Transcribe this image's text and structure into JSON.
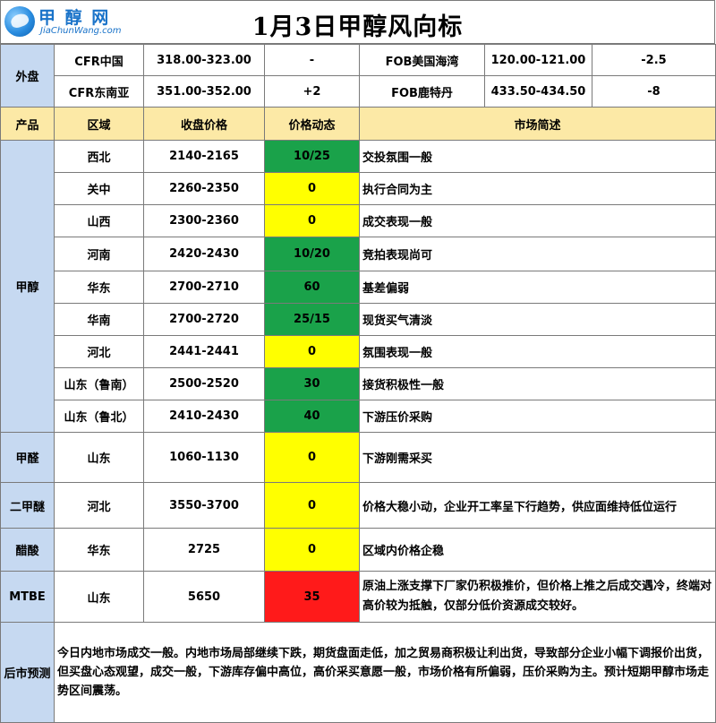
{
  "header": {
    "title": "1月3日甲醇风向标",
    "logo_cn": "甲 醇 网",
    "logo_en": "JiaChunWang.com"
  },
  "external": {
    "category": "外盘",
    "rows": [
      {
        "name1": "CFR中国",
        "price1": "318.00-323.00",
        "change1": "-",
        "name2": "FOB美国海湾",
        "price2": "120.00-121.00",
        "change2": "-2.5"
      },
      {
        "name1": "CFR东南亚",
        "price1": "351.00-352.00",
        "change1": "+2",
        "name2": "FOB鹿特丹",
        "price2": "433.50-434.50",
        "change2": "-8"
      }
    ]
  },
  "columns": {
    "product": "产品",
    "region": "区域",
    "price": "收盘价格",
    "change": "价格动态",
    "comment": "市场简述"
  },
  "products": [
    {
      "name": "甲醇",
      "rows": [
        {
          "region": "西北",
          "price": "2140-2165",
          "change": "10/25",
          "status": "green",
          "comment": "交投氛围一般"
        },
        {
          "region": "关中",
          "price": "2260-2350",
          "change": "0",
          "status": "yellow",
          "comment": "执行合同为主"
        },
        {
          "region": "山西",
          "price": "2300-2360",
          "change": "0",
          "status": "yellow",
          "comment": "成交表现一般"
        },
        {
          "region": "河南",
          "price": "2420-2430",
          "change": "10/20",
          "status": "green",
          "comment": "竞拍表现尚可"
        },
        {
          "region": "华东",
          "price": "2700-2710",
          "change": "60",
          "status": "green",
          "comment": "基差偏弱"
        },
        {
          "region": "华南",
          "price": "2700-2720",
          "change": "25/15",
          "status": "green",
          "comment": "现货买气清淡"
        },
        {
          "region": "河北",
          "price": "2441-2441",
          "change": "0",
          "status": "yellow",
          "comment": "氛围表现一般"
        },
        {
          "region": "山东（鲁南）",
          "price": "2500-2520",
          "change": "30",
          "status": "green",
          "comment": "接货积极性一般"
        },
        {
          "region": "山东（鲁北）",
          "price": "2410-2430",
          "change": "40",
          "status": "green",
          "comment": "下游压价采购"
        }
      ]
    },
    {
      "name": "甲醛",
      "rows": [
        {
          "region": "山东",
          "price": "1060-1130",
          "change": "0",
          "status": "yellow",
          "comment": "下游刚需采买"
        }
      ]
    },
    {
      "name": "二甲醚",
      "rows": [
        {
          "region": "河北",
          "price": "3550-3700",
          "change": "0",
          "status": "yellow",
          "comment": "价格大稳小动，企业开工率呈下行趋势，供应面维持低位运行"
        }
      ]
    },
    {
      "name": "醋酸",
      "rows": [
        {
          "region": "华东",
          "price": "2725",
          "change": "0",
          "status": "yellow",
          "comment": "区域内价格企稳"
        }
      ]
    },
    {
      "name": "MTBE",
      "rows": [
        {
          "region": "山东",
          "price": "5650",
          "change": "35",
          "status": "red",
          "comment": "原油上涨支撑下厂家仍积极推价，但价格上推之后成交遇冷，终端对高价较为抵触，仅部分低价资源成交较好。"
        }
      ]
    }
  ],
  "forecast": {
    "label": "后市预测",
    "text": "今日内地市场成交一般。内地市场局部继续下跌，期货盘面走低，加之贸易商积极让利出货，导致部分企业小幅下调报价出货，但买盘心态观望，成交一般，下游库存偏中高位，高价采买意愿一般，市场价格有所偏弱，压价采购为主。预计短期甲醇市场走势区间震荡。"
  },
  "colors": {
    "green": "#1aa24a",
    "yellow": "#ffff00",
    "red": "#ff1a1a",
    "category_bg": "#c6d9f1",
    "header_bg": "#fce9a6"
  }
}
